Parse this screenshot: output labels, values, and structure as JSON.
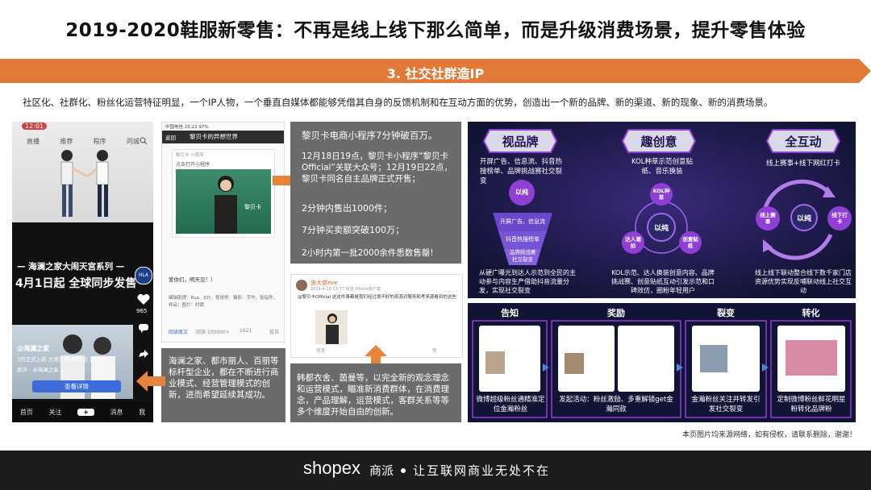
{
  "title": "2019-2020鞋服新零售：不再是线上线下那么简单，而是升级消费场景，提升零售体验",
  "section_heading": "3. 社交社群造IP",
  "intro": "社区化、社群化、粉丝化运营特征明显，一个IP人物，一个垂直自媒体都能够凭借其自身的反馈机制和在互动方面的优势，创造出一个新的品牌、新的渠道、新的现象、新的消费场景。",
  "douyin": {
    "time": "12:01",
    "top_tabs": [
      "直播",
      "推荐",
      "程序",
      "同城"
    ],
    "banner_line1": "— 海澜之家大闹天宫系列 —",
    "banner_line2": "4月1日起 全球同步发售",
    "badge": "HLA",
    "likes": "965",
    "account": "@海澜之家",
    "caption": "3月正式上新 大闹天宫 4月1日 是 如可...",
    "music": "原声 · @海澜之家...",
    "cta": "查看详情",
    "nav": [
      "首页",
      "关注",
      "+",
      "消息",
      "我"
    ]
  },
  "wechat": {
    "status": "中国电信 15:22 97%",
    "back": "返回",
    "title": "黎贝卡的异想世界",
    "mini_label": "黎贝卡 小程序",
    "mini_cta": "点击打开小程序",
    "watermark": "黎贝卡",
    "greeting": "爱你们，明天见！）",
    "credits": "编辑助理：Rua、JOY，视觉师：摄影：宇华，张指号，样品：图片：时蔬",
    "read_text": "阅读原文",
    "read_count": "阅读 100000+",
    "likes": "1621",
    "report": "投诉"
  },
  "libeika_box": {
    "headline": "黎贝卡电商小程序7分钟破百万。",
    "para1": "12月18日19点，黎贝卡小程序“黎贝卡Official”关联大众号；12月19日22点，黎贝卡同名自主品牌正式开售；",
    "stat1": "2分钟内售出1000件；",
    "stat2": "7分钟买卖额突破100万；",
    "stat3": "2小时内第一批2000余件悉数售罄!"
  },
  "weibo": {
    "user": "张大奕eve",
    "meta": "2019-4-28 17:37 来自 iPhone客户端",
    "text": "@黎贝卡Official 这这件事都是我们经过很不好的资源对服务和考来源看到的这些",
    "actions": [
      "转发",
      "82",
      "赞"
    ]
  },
  "hailan_box": {
    "text": "海澜之家、都市丽人、百丽等标杆型企业，都在不断进行商业模式、经营管理模式的创新，进而希望延续其成功。"
  },
  "hanfu_box": {
    "text": "韩都衣舍、茵曼等，以完全新的观念理念和运营模式，瞄准新消费群体，在消费理念，产品理解，运营模式，客群关系等等多个维度开始自由的创新。"
  },
  "pillars": {
    "cols": [
      {
        "title": "视品牌",
        "desc": "开屏广告、信息流、抖音热搜榜单、品牌挑战赛社交裂变",
        "circle": "以纯",
        "funnel": [
          "开屏广告、信息流",
          "抖音热搜榜单",
          "品牌挑战赛",
          "社交裂变"
        ],
        "bottom": "从硬广曝光到达人示范到全民的主动参与内容生产借助抖音流量分发，实现社交裂变"
      },
      {
        "title": "趣创意",
        "desc": "KOL种草示范创意贴纸、音乐换装",
        "circle": "以纯",
        "sats": [
          "KOL种草",
          "达人潮拍",
          "创意贴纸"
        ],
        "bottom": "KOL示范、达人换装创意内容、品牌挑战赛、创意贴纸互动引发示范和口碑效仿，圈粉年轻用户"
      },
      {
        "title": "全互动",
        "desc": "线上赛事+线下网红打卡",
        "circle": "以纯",
        "sats": [
          "线上赛事",
          "线下打卡"
        ],
        "bottom": "线上线下联动整合线下数千家门店资源优势实现反哺联动线上社交互动"
      }
    ]
  },
  "flow": {
    "steps": [
      {
        "label": "告知",
        "caption": "微博超级粉丝通精准定位金瀚粉丝"
      },
      {
        "label": "奖励",
        "caption": "发起活动：粉丝激励、多重解锁get金瀚同款"
      },
      {
        "label": "裂变",
        "caption": "金瀚粉丝关注并转发引发社交裂变"
      },
      {
        "label": "转化",
        "caption": "定制微博粉丝鲜花明星粉转化品牌粉"
      }
    ]
  },
  "disclaimer": "本页图片均来源网络，如有侵权，请联系删除，谢谢！",
  "footer": {
    "brand": "shopex",
    "brand_cn": "商派",
    "slogan": "让互联网商业无处不在"
  },
  "colors": {
    "orange": "#e8833a",
    "band": "#e07a36",
    "grey_box": "#6b6b6b",
    "dark_panel": "#121436",
    "purple_accent": "#8f3fd6",
    "footer_bg": "#1c1c1c"
  },
  "icons": [
    "arrow-right-icon",
    "arrow-left-icon",
    "arrow-up-icon",
    "heart-icon",
    "comment-icon",
    "share-icon",
    "search-icon",
    "plus-icon"
  ]
}
